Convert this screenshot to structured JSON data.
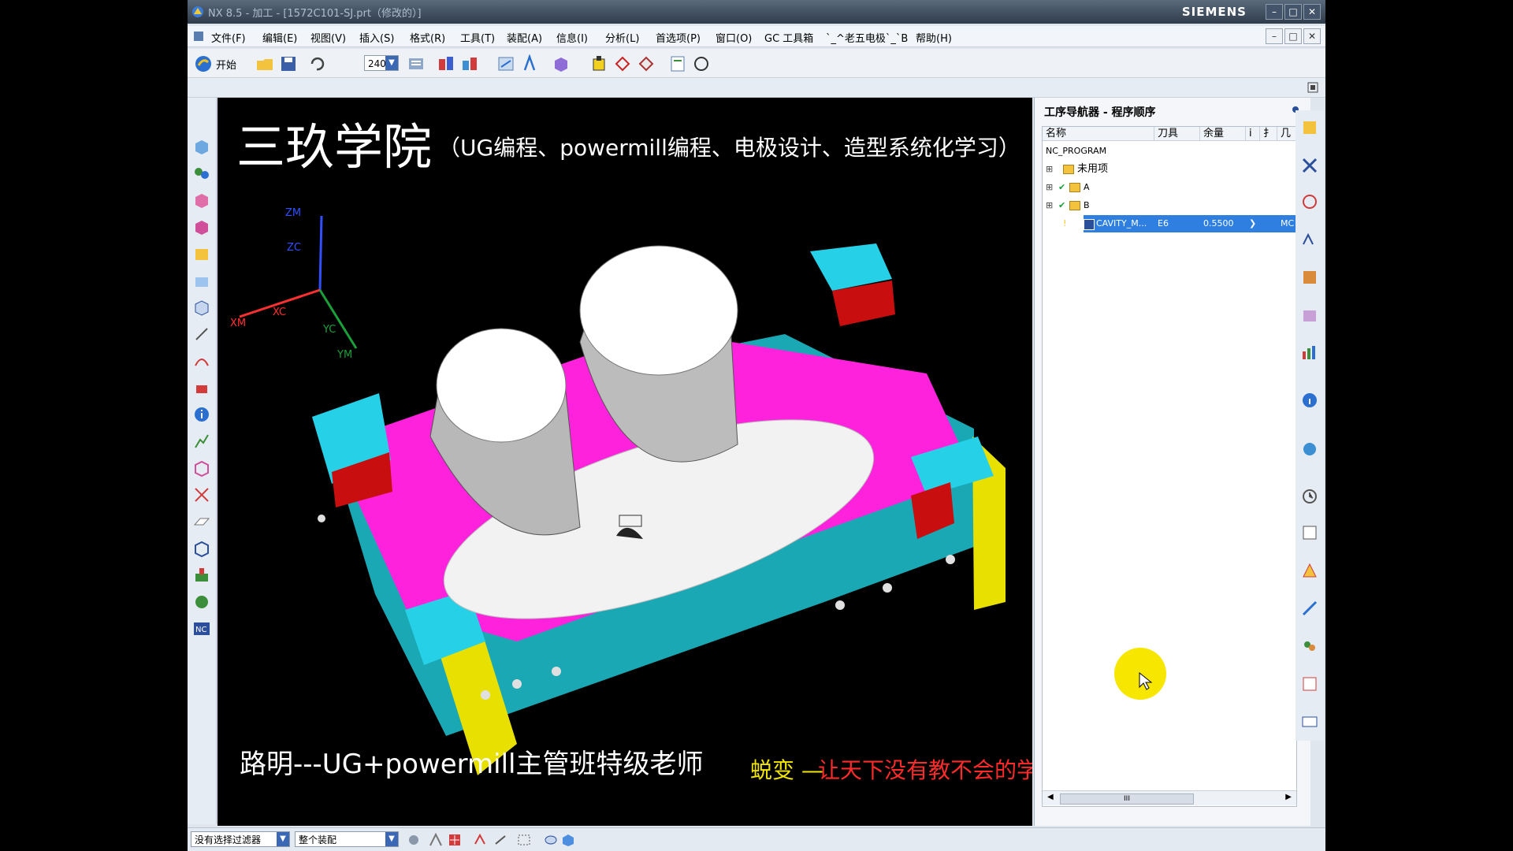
{
  "window": {
    "title": "NX 8.5 - 加工 - [1572C101-SJ.prt（修改的）]",
    "brand": "SIEMENS",
    "minimize": "–",
    "maximize": "□",
    "close": "✕"
  },
  "menu": {
    "items": [
      "文件(F)",
      "编辑(E)",
      "视图(V)",
      "插入(S)",
      "格式(R)",
      "工具(T)",
      "装配(A)",
      "信息(I)",
      "分析(L)",
      "首选项(P)",
      "窗口(O)",
      "GC 工具箱",
      "`_^老五电极`_`B",
      "帮助(H)"
    ]
  },
  "toolbar": {
    "start_label": "开始",
    "zoom_value": "240"
  },
  "viewport": {
    "overlay_title": "三玖学院",
    "overlay_subtitle": "（UG编程、powermill编程、电极设计、造型系统化学习）",
    "caption_left": "路明---UG+powermill主管班特级老师",
    "caption_right_prefix": "蜕变 —",
    "caption_right": "让天下没有教不会的学生",
    "axes": {
      "zm": "ZM",
      "zc": "ZC",
      "xm": "XM",
      "xc": "XC",
      "yc": "YC",
      "ym": "YM"
    }
  },
  "navigator": {
    "title": "工序导航器 - 程序顺序",
    "columns": [
      "名称",
      "刀具",
      "余量",
      "i",
      "扌",
      "几"
    ],
    "rows": [
      {
        "name": "NC_PROGRAM",
        "tool": "",
        "stock": "",
        "level": 0
      },
      {
        "name": "未用项",
        "tool": "",
        "stock": "",
        "level": 1
      },
      {
        "name": "A",
        "tool": "",
        "stock": "",
        "level": 1
      },
      {
        "name": "B",
        "tool": "",
        "stock": "",
        "level": 1
      },
      {
        "name": "CAVITY_M...",
        "tool": "E6",
        "stock": "0.5500",
        "level": 2,
        "extra": "MC"
      }
    ],
    "scroll_indicator": "III"
  },
  "statusbar": {
    "filter": "没有选择过滤器",
    "scope": "整个装配"
  },
  "colors": {
    "pink": "#ff22dd",
    "teal": "#1aa8b5",
    "cyan": "#26d1e8",
    "yellow": "#f2e600",
    "red": "#c80e0e",
    "selection": "#2f7fe0"
  }
}
